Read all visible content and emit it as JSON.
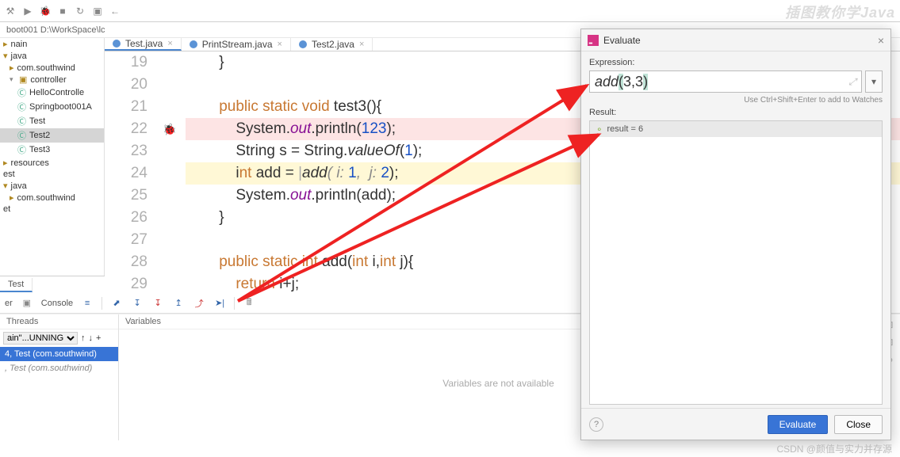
{
  "breadcrumb": "boot001  D:\\WorkSpace\\lc",
  "toolbar_icons": [
    "play",
    "bug",
    "stop",
    "sync",
    "box",
    "gear"
  ],
  "tabs": [
    {
      "label": "Test.java",
      "active": true
    },
    {
      "label": "PrintStream.java",
      "active": false
    },
    {
      "label": "Test2.java",
      "active": false
    }
  ],
  "project": {
    "items": [
      {
        "label": "nain",
        "indent": 0,
        "icon": "folder"
      },
      {
        "label": "java",
        "indent": 0,
        "icon": "folder"
      },
      {
        "label": "com.southwind",
        "indent": 1,
        "icon": "pkg"
      },
      {
        "label": "controller",
        "indent": 1,
        "icon": "pkg",
        "expanded": true
      },
      {
        "label": "HelloControlle",
        "indent": 2,
        "icon": "class"
      },
      {
        "label": "Springboot001A",
        "indent": 2,
        "icon": "class"
      },
      {
        "label": "Test",
        "indent": 2,
        "icon": "class"
      },
      {
        "label": "Test2",
        "indent": 2,
        "icon": "class",
        "selected": true
      },
      {
        "label": "Test3",
        "indent": 2,
        "icon": "class"
      },
      {
        "label": "resources",
        "indent": 0,
        "icon": "folder"
      },
      {
        "label": "est",
        "indent": 0,
        "icon": "folder"
      },
      {
        "label": "java",
        "indent": 0,
        "icon": "folder"
      },
      {
        "label": "com.southwind",
        "indent": 1,
        "icon": "pkg"
      },
      {
        "label": "et",
        "indent": 0,
        "icon": "folder"
      }
    ]
  },
  "gutter": {
    "start": 19,
    "end": 29,
    "breakpoint_line": 22
  },
  "code": {
    "l19": "        }",
    "l20": "",
    "l21_pre": "        ",
    "l21_a": "public static void",
    "l21_b": " test3(){",
    "l22_pre": "            System.",
    "l22_out": "out",
    "l22_mid": ".println(",
    "l22_num": "123",
    "l22_end": ");",
    "l23_pre": "            String s = String.",
    "l23_m": "valueOf",
    "l23_p": "(",
    "l23_n": "1",
    "l23_e": ");",
    "l24_pre": "            i",
    "l24_nt": "nt",
    "l24_a": " add = ",
    "l24_bar": "|",
    "l24_m": "add",
    "l24_p1": "( i: ",
    "l24_n1": "1",
    "l24_c": ",  j: ",
    "l24_n2": "2",
    "l24_e": ");",
    "l25_pre": "            System.",
    "l25_out": "out",
    "l25_mid": ".println(add);",
    "l26": "        }",
    "l27": "",
    "l28_pre": "        ",
    "l28_a": "public static int",
    "l28_b": " add(",
    "l28_c": "int",
    "l28_d": " i,",
    "l28_e": "int",
    "l28_f": " j){",
    "l29_pre": "            ",
    "l29_a": "return",
    "l29_b": " i+j;"
  },
  "lower_tab": "Test",
  "debug": {
    "left_label": "er",
    "console_label": "Console",
    "threads_header": "Threads",
    "variables_header": "Variables",
    "running_thread": "ain\"...UNNING",
    "frame1": "4, Test (com.southwind)",
    "frame2": ", Test (com.southwind)",
    "vars_placeholder": "Variables are not available"
  },
  "dialog": {
    "title": "Evaluate",
    "expr_label": "Expression:",
    "expr_fn": "add",
    "expr_open": "(",
    "expr_args": "3,3",
    "expr_close": ")",
    "hint": "Use Ctrl+Shift+Enter to add to Watches",
    "result_label": "Result:",
    "result_text": "result = 6",
    "btn_eval": "Evaluate",
    "btn_close": "Close"
  },
  "watermark": "插图教你学Java",
  "csdn": "CSDN @颜值与实力并存源"
}
